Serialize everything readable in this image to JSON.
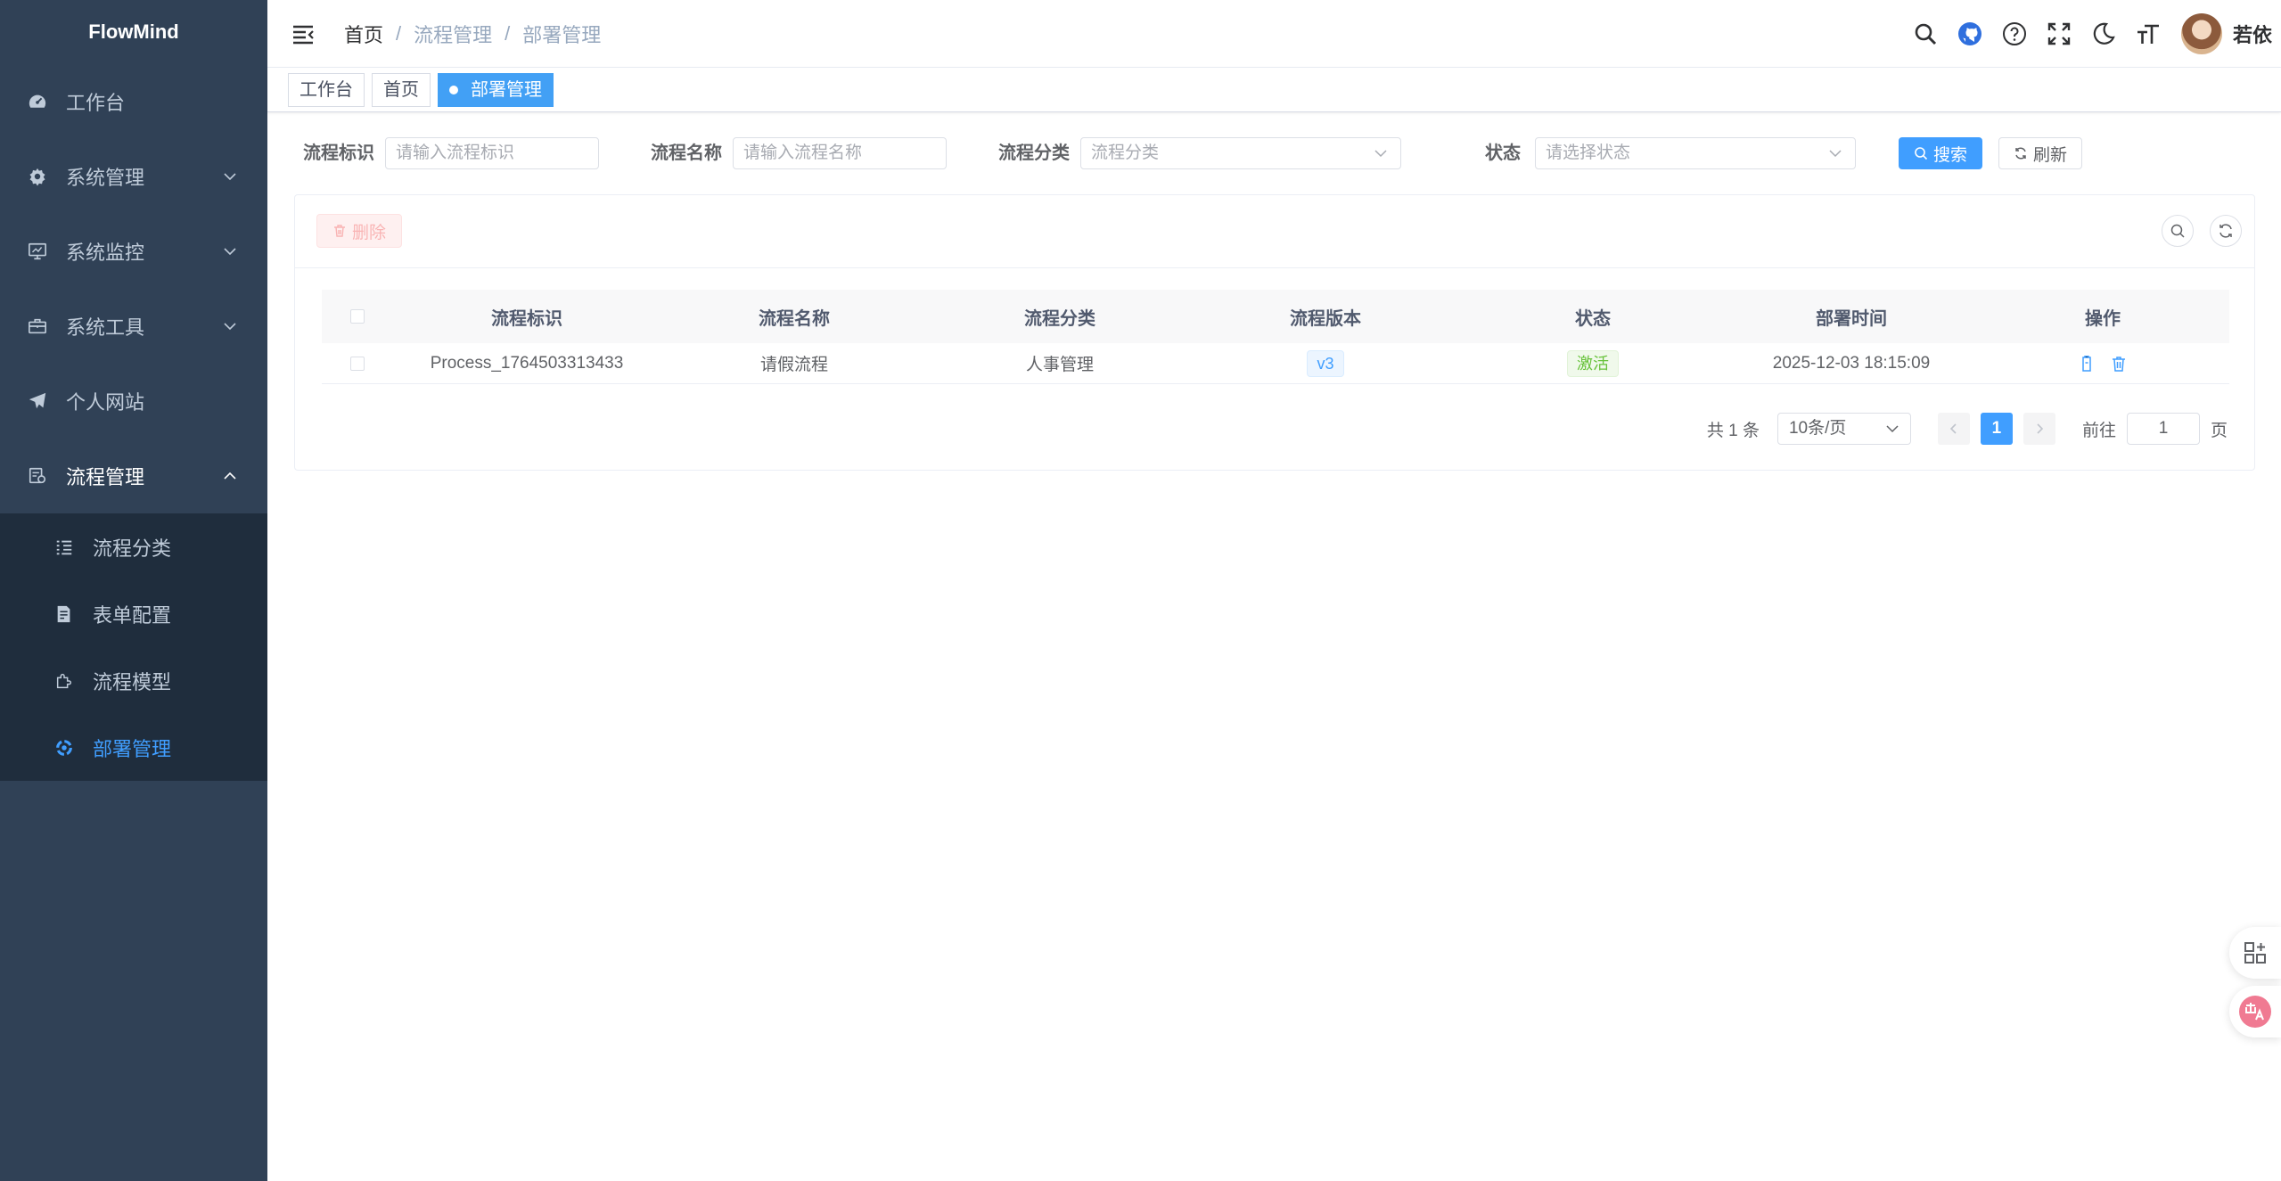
{
  "sidebar": {
    "logo": "FlowMind",
    "menu": [
      {
        "label": "工作台",
        "icon": "dashboard-icon"
      },
      {
        "label": "系统管理",
        "icon": "gear-icon"
      },
      {
        "label": "系统监控",
        "icon": "monitor-icon"
      },
      {
        "label": "系统工具",
        "icon": "toolbox-icon"
      },
      {
        "label": "个人网站",
        "icon": "send-icon"
      },
      {
        "label": "流程管理",
        "icon": "workflow-icon"
      }
    ],
    "submenu": [
      {
        "label": "流程分类",
        "icon": "list-icon"
      },
      {
        "label": "表单配置",
        "icon": "form-icon"
      },
      {
        "label": "流程模型",
        "icon": "puzzle-icon"
      },
      {
        "label": "部署管理",
        "icon": "deploy-icon"
      }
    ]
  },
  "navbar": {
    "breadcrumb": [
      "首页",
      "流程管理",
      "部署管理"
    ],
    "username": "若依"
  },
  "tags": [
    "工作台",
    "首页",
    "部署管理"
  ],
  "search": {
    "process_key_label": "流程标识",
    "process_key_placeholder": "请输入流程标识",
    "process_name_label": "流程名称",
    "process_name_placeholder": "请输入流程名称",
    "category_label": "流程分类",
    "category_placeholder": "流程分类",
    "status_label": "状态",
    "status_placeholder": "请选择状态",
    "search_button": "搜索",
    "reset_button": "刷新"
  },
  "toolbar": {
    "delete_button": "删除"
  },
  "table": {
    "headers": [
      "流程标识",
      "流程名称",
      "流程分类",
      "流程版本",
      "状态",
      "部署时间",
      "操作"
    ],
    "rows": [
      {
        "key": "Process_1764503313433",
        "name": "请假流程",
        "category": "人事管理",
        "version": "v3",
        "status": "激活",
        "deploy_time": "2025-12-03 18:15:09"
      }
    ]
  },
  "pagination": {
    "total": "共 1 条",
    "page_size": "10条/页",
    "current_page": "1",
    "goto_label": "前往",
    "goto_value": "1",
    "page_unit": "页"
  },
  "colors": {
    "sidebar_bg": "#304156",
    "submenu_bg": "#1f2d3d",
    "primary": "#409eff",
    "success": "#67c23a"
  }
}
